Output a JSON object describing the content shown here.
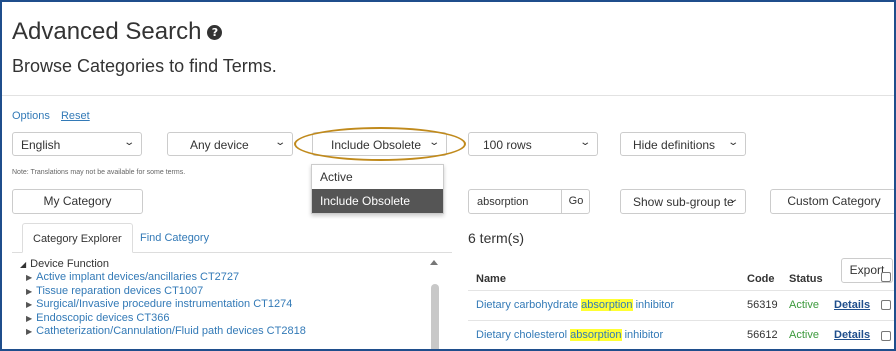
{
  "header": {
    "title": "Advanced Search",
    "subtitle": "Browse Categories to find Terms."
  },
  "options": {
    "label": "Options",
    "reset": "Reset"
  },
  "filters": {
    "language": "English",
    "device": "Any device",
    "obsolete": "Include Obsolete",
    "rows": "100 rows",
    "definitions": "Hide definitions"
  },
  "obsolete_dropdown": {
    "options": [
      "Active",
      "Include Obsolete"
    ],
    "selected": "Include Obsolete"
  },
  "note": "Note: Translations may not be available for some terms.",
  "buttons": {
    "my_category": "My Category",
    "go": "Go",
    "custom_category": "Custom Category",
    "export": "Export"
  },
  "search": {
    "value": "absorption",
    "subgroup": "Show sub-group te"
  },
  "tabs": {
    "explorer": "Category Explorer",
    "find": "Find Category"
  },
  "tree": {
    "root": "Device Function",
    "items": [
      "Active implant devices/ancillaries CT2727",
      "Tissue reparation devices CT1007",
      "Surgical/Invasive procedure instrumentation CT1274",
      "Endoscopic devices CT366",
      "Catheterization/Cannulation/Fluid path devices CT2818"
    ]
  },
  "results": {
    "count": "6 term(s)",
    "columns": {
      "name": "Name",
      "code": "Code",
      "status": "Status"
    },
    "rows": [
      {
        "pre": "Dietary carbohydrate ",
        "highlight": "absorption",
        "post": " inhibitor",
        "code": "56319",
        "status": "Active",
        "details": "Details"
      },
      {
        "pre": "Dietary cholesterol ",
        "highlight": "absorption",
        "post": " inhibitor",
        "code": "56612",
        "status": "Active",
        "details": "Details"
      }
    ]
  },
  "colors": {
    "accent": "#337ab7",
    "highlight": "#ffff33",
    "oval": "#c08a1c",
    "active": "#3c9a3c"
  }
}
